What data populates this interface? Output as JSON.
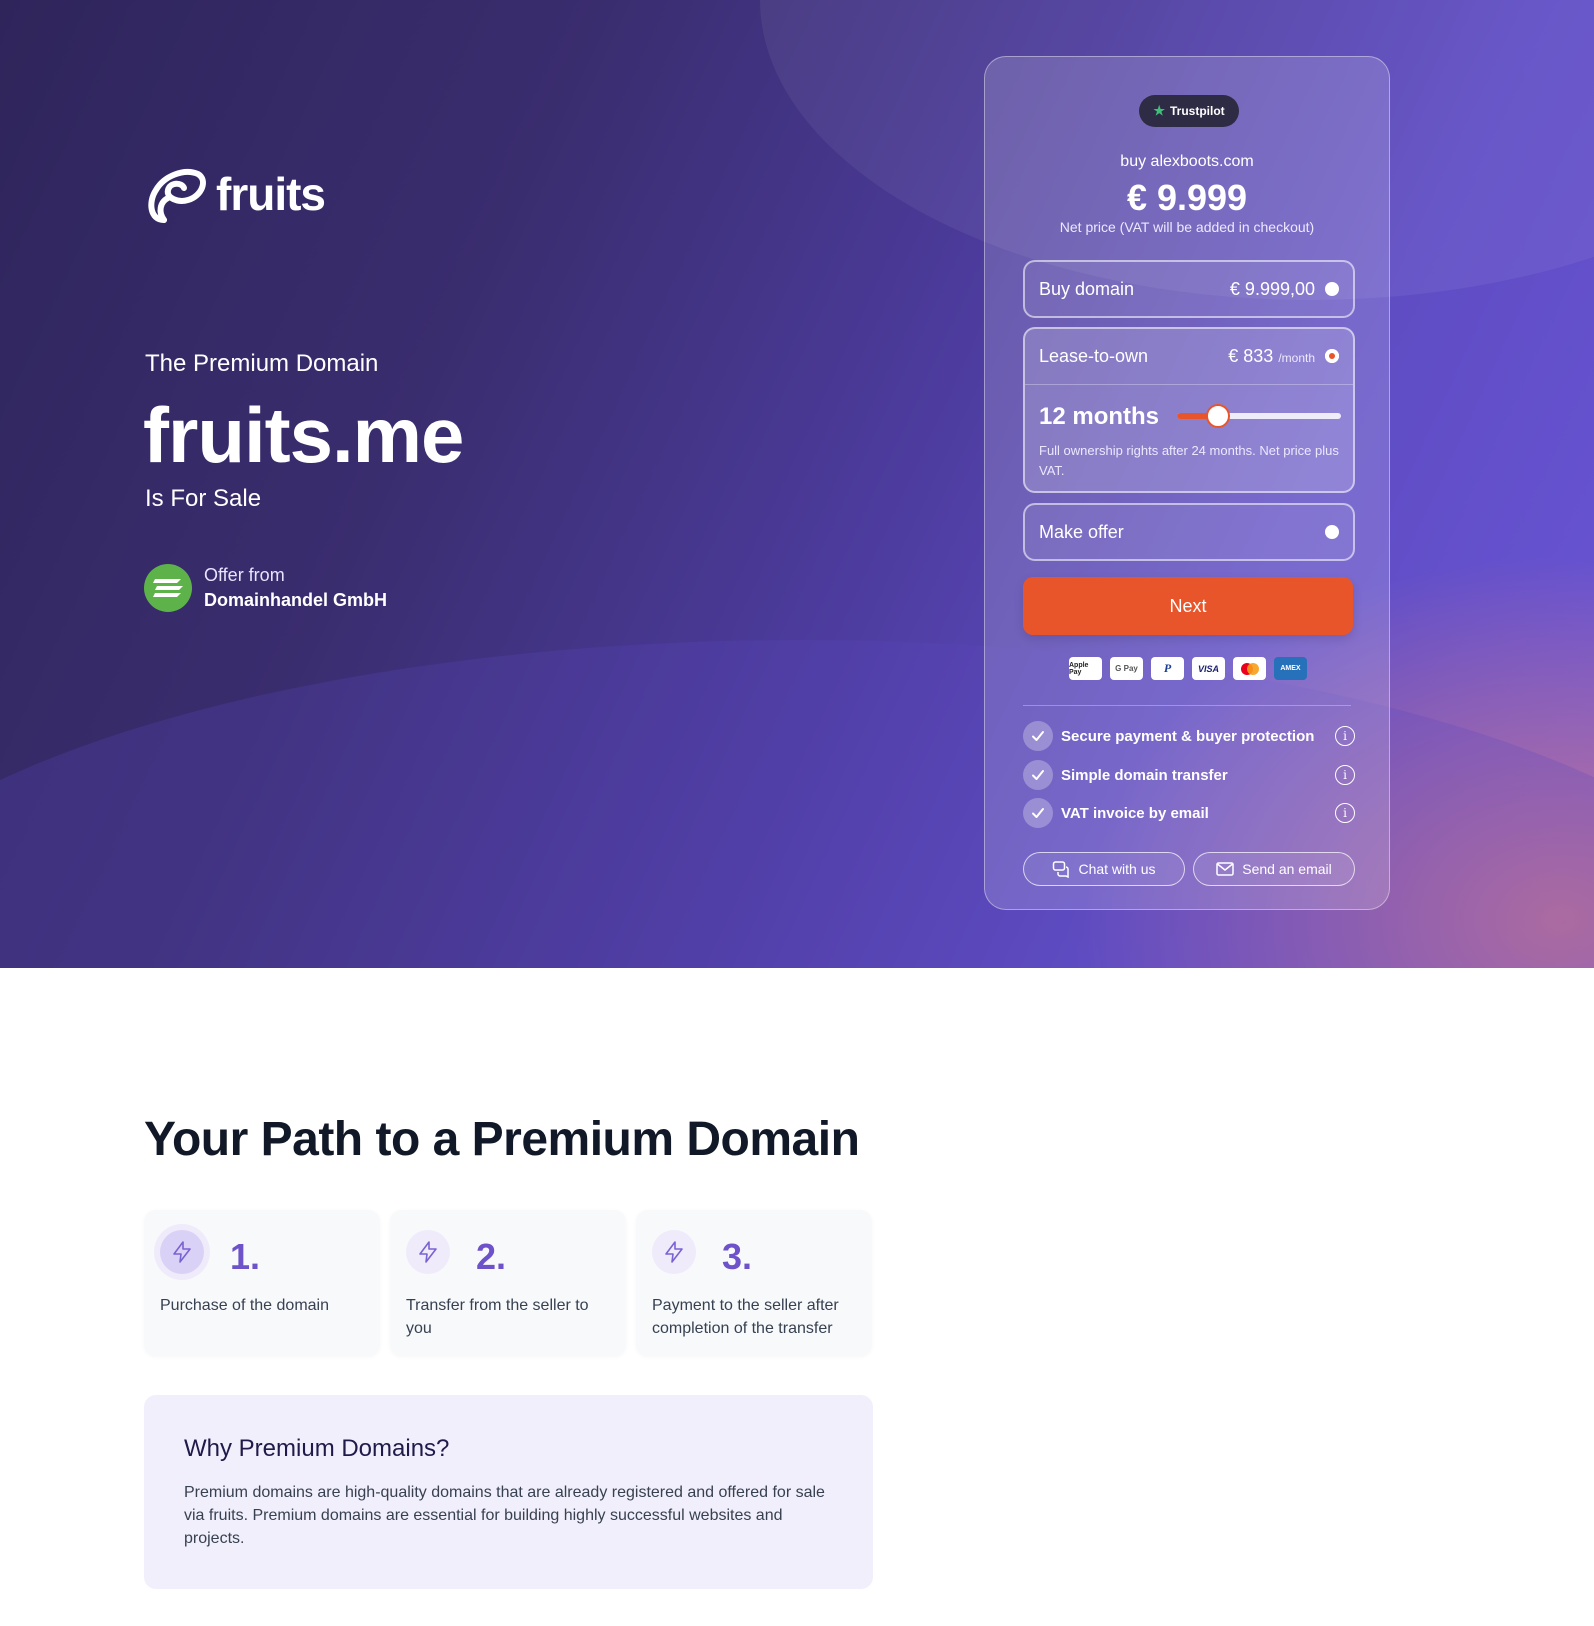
{
  "brand": {
    "name": "fruits"
  },
  "hero": {
    "subtitle": "The Premium Domain",
    "domain": "fruits.me",
    "for_sale": "Is For Sale",
    "offer_from": "Offer from",
    "company": "Domainhandel GmbH"
  },
  "card": {
    "trustpilot": "Trustpilot",
    "buy_line": "buy alexboots.com",
    "price": "€ 9.999",
    "net_note": "Net price (VAT will be added in checkout)",
    "options": {
      "buy": {
        "label": "Buy domain",
        "amount": "€ 9.999,00",
        "selected": false
      },
      "lease": {
        "label": "Lease-to-own",
        "amount": "€ 833",
        "unit": "/month",
        "selected": true,
        "months_label": "12 months",
        "slider_fraction": 0.25,
        "note": "Full ownership rights after 24 months. Net price plus VAT."
      },
      "offer": {
        "label": "Make offer",
        "selected": false
      }
    },
    "next_label": "Next",
    "payment_methods": [
      "Apple Pay",
      "G Pay",
      "PayPal",
      "VISA",
      "Mastercard",
      "AMEX"
    ],
    "features": [
      "Secure payment & buyer protection",
      "Simple domain transfer",
      "VAT invoice by email"
    ],
    "chat_label": "Chat with us",
    "email_label": "Send an email"
  },
  "path": {
    "heading": "Your Path to a Premium Domain",
    "steps": [
      {
        "num": "1.",
        "text": "Purchase of the domain"
      },
      {
        "num": "2.",
        "text": "Transfer from the seller to you"
      },
      {
        "num": "3.",
        "text": "Payment to the seller after completion of the transfer"
      }
    ]
  },
  "why": {
    "title": "Why Premium Domains?",
    "body": "Premium domains are high-quality domains that are already registered and offered for sale via fruits. Premium domains are essential for building highly successful websites and projects."
  },
  "colors": {
    "accent": "#e8552a",
    "brand_purple": "#6d52c9",
    "hero_dark": "#2f255b"
  }
}
